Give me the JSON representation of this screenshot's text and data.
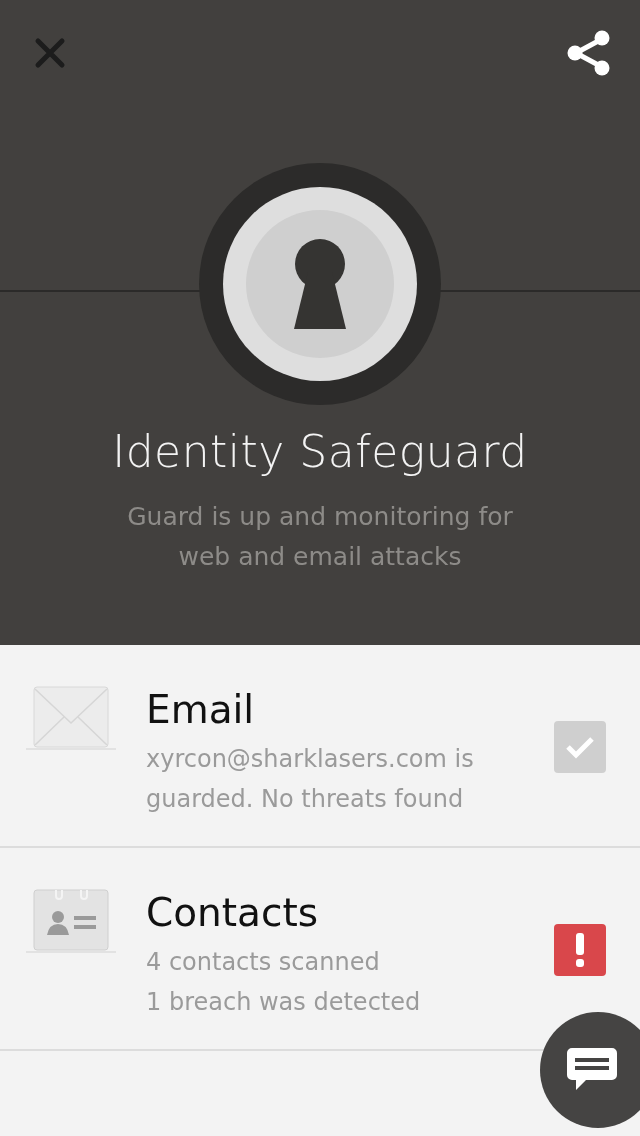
{
  "header": {
    "title": "Identity Safeguard",
    "subtitle_lines": [
      "Guard is up and monitoring for",
      "web and email attacks"
    ]
  },
  "items": [
    {
      "kind": "email",
      "title": "Email",
      "lines": [
        "xyrcon@sharklasers.com is",
        "guarded. No threats found"
      ],
      "alert": false
    },
    {
      "kind": "contacts",
      "title": "Contacts",
      "lines": [
        "4 contacts scanned",
        "1 breach was detected"
      ],
      "alert": true
    }
  ]
}
